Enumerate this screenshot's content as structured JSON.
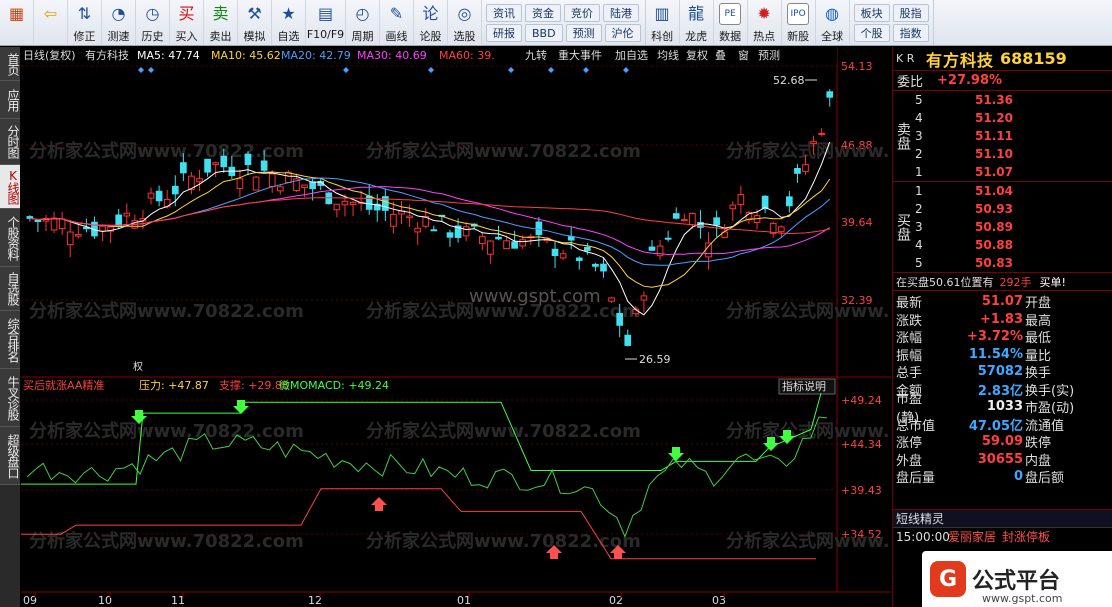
{
  "toolbar": {
    "buttons": [
      {
        "label": "",
        "icon": "windows-icon"
      },
      {
        "label": "",
        "icon": "back-arrow-icon"
      },
      {
        "label": "修正",
        "icon": "up-down-arrows-icon"
      },
      {
        "label": "测速",
        "icon": "speed-icon"
      },
      {
        "label": "历史",
        "icon": "clock-icon"
      },
      {
        "label": "买入",
        "icon": "buy-icon"
      },
      {
        "label": "卖出",
        "icon": "sell-icon"
      },
      {
        "label": "模拟",
        "icon": "gavel-icon"
      },
      {
        "label": "自选",
        "icon": "star-icon"
      },
      {
        "label": "F10/F9",
        "icon": "f10-icon"
      },
      {
        "label": "周期",
        "icon": "period-icon"
      },
      {
        "label": "画线",
        "icon": "pencil-icon"
      },
      {
        "label": "论股",
        "icon": "discuss-icon"
      },
      {
        "label": "选股",
        "icon": "select-stock-icon"
      }
    ],
    "grid1": [
      [
        "资讯",
        "资金",
        "竞价",
        "陆港"
      ],
      [
        "研报",
        "BBD",
        "预测",
        "沪伦"
      ]
    ],
    "buttons2": [
      {
        "label": "科创",
        "icon": "sci-tech-icon"
      },
      {
        "label": "龙虎",
        "icon": "dragon-tiger-icon"
      },
      {
        "label": "数据",
        "icon": "pe-data-icon"
      },
      {
        "label": "热点",
        "icon": "hot-icon"
      },
      {
        "label": "新股",
        "icon": "ipo-icon"
      },
      {
        "label": "全球",
        "icon": "globe-icon"
      }
    ],
    "grid2": [
      [
        "板块",
        "股指"
      ],
      [
        "个股",
        "指数"
      ]
    ]
  },
  "left_tabs": [
    "首页",
    "应用",
    "分时图",
    "K线图",
    "个股资料",
    "自选股",
    "综合排名",
    "牛叉诊股",
    "超级盘口"
  ],
  "active_tab": "K线图",
  "kline_header": {
    "period": "日线(复权)",
    "stock": "有方科技",
    "ma": [
      {
        "label": "MA5: 47.74",
        "color": "#ffffff"
      },
      {
        "label": "MA10: 45.62",
        "color": "#ffd23a"
      },
      {
        "label": "MA20: 42.79",
        "color": "#4aa0ff"
      },
      {
        "label": "MA30: 40.69",
        "color": "#ff40ff"
      },
      {
        "label": "MA60: 39.",
        "color": "#ff4040"
      }
    ],
    "tools": [
      "九转",
      "重大事件",
      "加自选",
      "均线",
      "复权",
      "叠",
      "窗",
      "预测"
    ]
  },
  "price_axis": [
    "54.13",
    "46.88",
    "39.64",
    "32.39"
  ],
  "high_label": "52.68",
  "low_label": "26.59",
  "event_label": "权",
  "indicator_header": {
    "name": "买后就涨AA精准",
    "pressure": "压力: +47.87",
    "support": "支撑: +29.88",
    "macd": "微MOMACD: +49.24",
    "help": "指标说明"
  },
  "indicator_axis": [
    "+49.24",
    "+44.34",
    "+39.43",
    "+34.52"
  ],
  "date_axis": [
    "09",
    "10",
    "11",
    "12",
    "01",
    "02",
    "03"
  ],
  "watermark": "分析家公式网www.70822.com",
  "watermark2": "www.gspt.com",
  "panel": {
    "market": "K R",
    "name": "有方科技",
    "code": "688159",
    "weibi_label": "委比",
    "weibi_value": "+27.98%",
    "sell_label": "卖盘",
    "sell": [
      [
        "5",
        "51.36"
      ],
      [
        "4",
        "51.20"
      ],
      [
        "3",
        "51.11"
      ],
      [
        "2",
        "51.10"
      ],
      [
        "1",
        "51.07"
      ]
    ],
    "buy_label": "买盘",
    "buy": [
      [
        "1",
        "51.04"
      ],
      [
        "2",
        "50.93"
      ],
      [
        "3",
        "50.89"
      ],
      [
        "4",
        "50.88"
      ],
      [
        "5",
        "50.83"
      ]
    ],
    "inbuy_text": "在买盘50.61位置有",
    "inbuy_qty": "292手",
    "inbuy_unit": "",
    "inbuy_action": "买单!",
    "stats": [
      {
        "k": "最新",
        "v": "51.07",
        "c": "red",
        "k2": "开盘"
      },
      {
        "k": "涨跌",
        "v": "+1.83",
        "c": "red",
        "k2": "最高"
      },
      {
        "k": "涨幅",
        "v": "+3.72%",
        "c": "red",
        "k2": "最低"
      },
      {
        "k": "振幅",
        "v": "11.54%",
        "c": "cyan",
        "k2": "量比"
      },
      {
        "k": "总手",
        "v": "57082",
        "c": "cyan",
        "k2": "换手"
      },
      {
        "k": "金额",
        "v": "2.83亿",
        "c": "cyan",
        "k2": "换手(实)"
      },
      {
        "k": "市盈(静)",
        "v": "1033",
        "c": "white",
        "k2": "市盈(动)"
      },
      {
        "k": "总市值",
        "v": "47.05亿",
        "c": "cyan",
        "k2": "流通值"
      },
      {
        "k": "涨停",
        "v": "59.09",
        "c": "red",
        "k2": "跌停"
      },
      {
        "k": "外盘",
        "v": "30655",
        "c": "red",
        "k2": "内盘"
      },
      {
        "k": "盘后量",
        "v": "0",
        "c": "cyan",
        "k2": "盘后额"
      }
    ],
    "wizard_title": "短线精灵",
    "wizard": [
      {
        "t": "15:00:00",
        "n": "爱丽家居",
        "s": "封涨停板"
      }
    ]
  },
  "logo": {
    "mark": "G",
    "text": "公式平台",
    "url": "www.gspt.com"
  },
  "colors": {
    "up": "#ff3030",
    "down": "#40e0f0",
    "bg": "#000000",
    "grid": "#7a0000"
  }
}
